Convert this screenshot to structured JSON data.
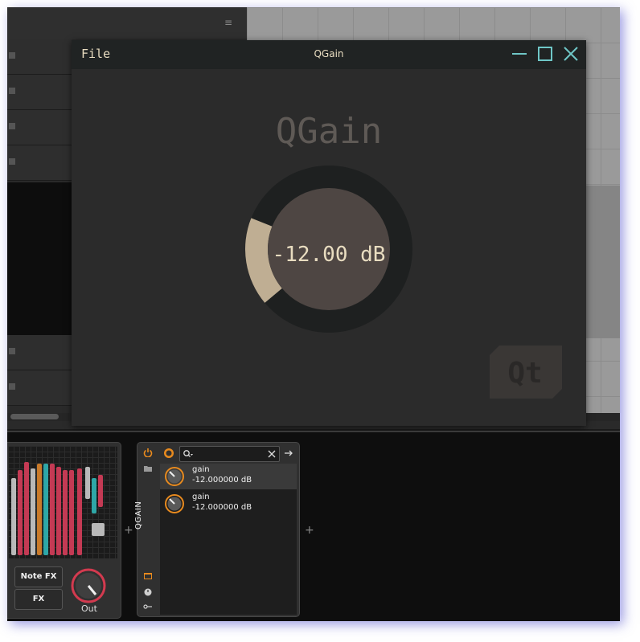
{
  "window": {
    "menu_file": "File",
    "title": "QGain",
    "heading": "QGain",
    "knob_value": "-12.00 dB",
    "gain_level_fraction": 0.22,
    "accent_color": "#bfae93",
    "logo_text": "Qt"
  },
  "device_chain": {
    "note_fx_label": "Note FX",
    "fx_label": "FX",
    "out_label": "Out",
    "plugin_side_label": "QGAIN",
    "params": [
      {
        "name": "gain",
        "value": "-12.000000 dB"
      },
      {
        "name": "gain",
        "value": "-12.000000 dB"
      }
    ],
    "add_symbol": "+"
  }
}
